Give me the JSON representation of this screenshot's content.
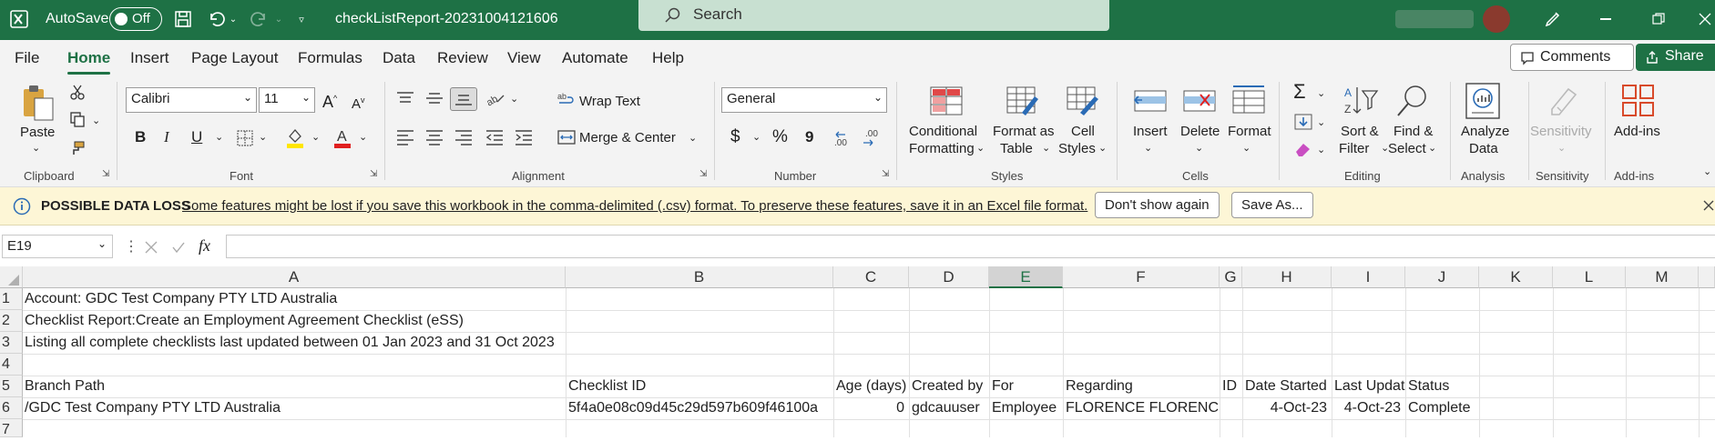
{
  "titlebar": {
    "autosave_label": "AutoSave",
    "autosave_state": "Off",
    "file_name": "checkListReport-20231004121606",
    "search_placeholder": "Search"
  },
  "menu": {
    "tabs": [
      "File",
      "Home",
      "Insert",
      "Page Layout",
      "Formulas",
      "Data",
      "Review",
      "View",
      "Automate",
      "Help"
    ],
    "comments": "Comments",
    "share": "Share"
  },
  "ribbon": {
    "clipboard": {
      "paste": "Paste",
      "group": "Clipboard"
    },
    "font": {
      "name": "Calibri",
      "size": "11",
      "group": "Font",
      "bold": "B",
      "italic": "I",
      "underline": "U"
    },
    "alignment": {
      "wrap": "Wrap Text",
      "merge": "Merge & Center",
      "group": "Alignment"
    },
    "number": {
      "format": "General",
      "dollar": "$",
      "percent": "%",
      "comma": "9",
      "group": "Number"
    },
    "styles": {
      "cond1": "Conditional",
      "cond2": "Formatting",
      "fmt1": "Format as",
      "fmt2": "Table",
      "cell1": "Cell",
      "cell2": "Styles",
      "group": "Styles"
    },
    "cells": {
      "insert": "Insert",
      "delete": "Delete",
      "format": "Format",
      "group": "Cells"
    },
    "editing": {
      "sort1": "Sort &",
      "sort2": "Filter",
      "find1": "Find &",
      "find2": "Select",
      "group": "Editing"
    },
    "analysis": {
      "a1": "Analyze",
      "a2": "Data",
      "group": "Analysis"
    },
    "sensitivity": {
      "label": "Sensitivity",
      "group": "Sensitivity"
    },
    "addins": {
      "label": "Add-ins",
      "group": "Add-ins"
    }
  },
  "warning": {
    "title": "POSSIBLE DATA LOSS",
    "message": "Some features might be lost if you save this workbook in the comma-delimited (.csv) format. To preserve these features, save it in an Excel file format.",
    "dont_show": "Don't show again",
    "save_as": "Save As..."
  },
  "formula_bar": {
    "name_box": "E19",
    "fx": "fx",
    "value": ""
  },
  "sheet": {
    "columns": [
      "A",
      "B",
      "C",
      "D",
      "E",
      "F",
      "G",
      "H",
      "I",
      "J",
      "K",
      "L",
      "M"
    ],
    "rows": [
      "1",
      "2",
      "3",
      "4",
      "5",
      "6",
      "7"
    ],
    "r1": {
      "a": "Account: GDC Test Company PTY LTD Australia"
    },
    "r2": {
      "a": "Checklist Report:Create an Employment Agreement Checklist (eSS)"
    },
    "r3": {
      "a": "Listing all complete checklists last updated between 01 Jan 2023 and 31 Oct 2023"
    },
    "r5": {
      "a": "Branch Path",
      "b": "Checklist ID",
      "c": "Age (days)",
      "d": "Created by",
      "e": "For",
      "f": "Regarding",
      "g": "ID",
      "h": "Date Started",
      "i": "Last Updat",
      "j": "Status"
    },
    "r6": {
      "a": "/GDC Test Company PTY LTD Australia",
      "b": "5f4a0e08c09d45c29d597b609f46100a",
      "c": "0",
      "d": "gdcauuser",
      "e": "Employee",
      "f": "FLORENCE FLORENCE",
      "g": "",
      "h": "4-Oct-23",
      "i": "4-Oct-23",
      "j": "Complete"
    }
  }
}
